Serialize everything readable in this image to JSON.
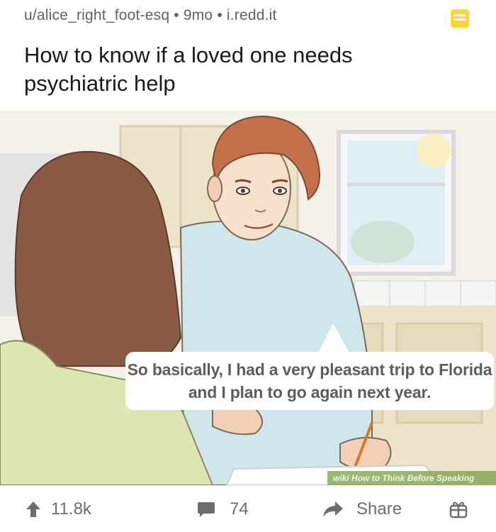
{
  "post": {
    "author": "u/alice_right_foot-esq",
    "separator1": " • ",
    "age": "9mo",
    "separator2": " • ",
    "domain": "i.redd.it",
    "title": "How to know if a loved one needs psychiatric help"
  },
  "image": {
    "caption": "So basically, I had a very pleasant trip to Florida and I plan to go again next year.",
    "watermark_prefix": "wiki",
    "watermark_text": "How to Think Before Speaking"
  },
  "footer": {
    "upvotes": "11.8k",
    "comments": "74",
    "share_label": "Share"
  },
  "colors": {
    "save_icon": "#ffd635",
    "footer_text": "#6b6e72"
  }
}
